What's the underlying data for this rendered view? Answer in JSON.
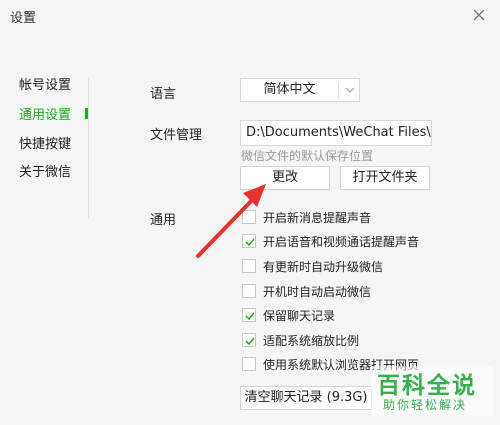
{
  "window": {
    "title": "设置"
  },
  "sidebar": {
    "items": [
      {
        "label": "帐号设置",
        "active": false
      },
      {
        "label": "通用设置",
        "active": true
      },
      {
        "label": "快捷按键",
        "active": false
      },
      {
        "label": "关于微信",
        "active": false
      }
    ]
  },
  "language": {
    "label": "语言",
    "value": "简体中文"
  },
  "file_management": {
    "label": "文件管理",
    "path": "D:\\Documents\\WeChat Files\\",
    "hint": "微信文件的默认保存位置",
    "change_label": "更改",
    "open_folder_label": "打开文件夹"
  },
  "general": {
    "label": "通用",
    "options": [
      {
        "label": "开启新消息提醒声音",
        "checked": false
      },
      {
        "label": "开启语音和视频通话提醒声音",
        "checked": true
      },
      {
        "label": "有更新时自动升级微信",
        "checked": false
      },
      {
        "label": "开机时自动启动微信",
        "checked": false
      },
      {
        "label": "保留聊天记录",
        "checked": true
      },
      {
        "label": "适配系统缩放比例",
        "checked": true
      },
      {
        "label": "使用系统默认浏览器打开网页",
        "checked": false
      }
    ],
    "clear_history_label": "清空聊天记录 (9.3G)"
  },
  "watermark": {
    "main": "百科全说",
    "sub": "助你轻松解决"
  },
  "colors": {
    "accent": "#1aad19",
    "annotation_arrow": "#e8322e",
    "watermark": "#34b14c"
  }
}
